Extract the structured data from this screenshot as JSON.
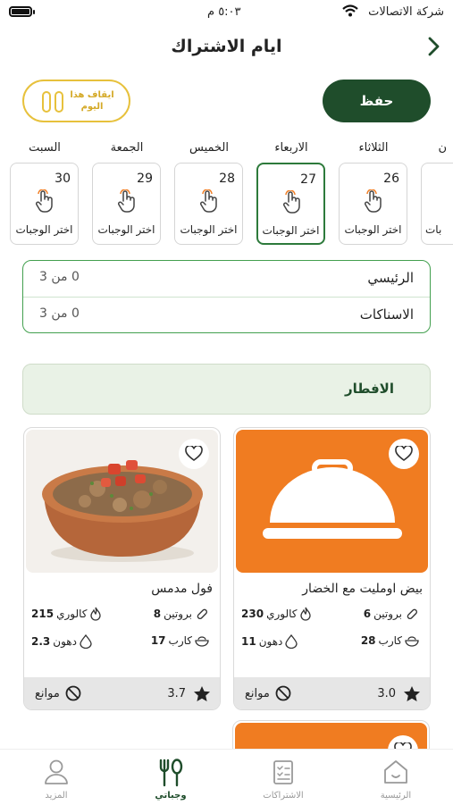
{
  "status_bar": {
    "carrier": "شركة الاتصالات",
    "time": "٥:٠٣ م"
  },
  "header": {
    "title": "ايام الاشتراك"
  },
  "actions": {
    "save": "حفظ",
    "pause": "ايقاف هذا اليوم"
  },
  "days": [
    {
      "name": "السبت",
      "number": "30",
      "action": "اختر الوجبات",
      "selected": false
    },
    {
      "name": "الجمعة",
      "number": "29",
      "action": "اختر الوجبات",
      "selected": false
    },
    {
      "name": "الخميس",
      "number": "28",
      "action": "اختر الوجبات",
      "selected": false
    },
    {
      "name": "الاربعاء",
      "number": "27",
      "action": "اختر الوجبات",
      "selected": true
    },
    {
      "name": "الثلاثاء",
      "number": "26",
      "action": "اختر الوجبات",
      "selected": false
    },
    {
      "name": "ن",
      "number": "",
      "action": "بات",
      "selected": false
    }
  ],
  "meal_counts": [
    {
      "label": "الرئيسي",
      "value": "0 من 3"
    },
    {
      "label": "الاسناكات",
      "value": "0 من 3"
    }
  ],
  "section": {
    "title": "الافطار"
  },
  "nutrient_labels": {
    "protein": "بروتين",
    "calories": "كالوري",
    "carbs": "كارب",
    "fats": "دهون"
  },
  "meals": [
    {
      "name": "بيض اومليت مع الخضار",
      "protein": "6",
      "calories": "230",
      "carbs": "28",
      "fats": "11",
      "rating": "3.0",
      "allergens": "موانع",
      "image": "placeholder-cloche",
      "image_bg": "#f07c21"
    },
    {
      "name": "فول مدمس",
      "protein": "8",
      "calories": "215",
      "carbs": "17",
      "fats": "2.3",
      "rating": "3.7",
      "allergens": "موانع",
      "image": "foul-bowl"
    }
  ],
  "tabs": [
    {
      "label": "الرئيسية",
      "icon": "home-icon",
      "active": false
    },
    {
      "label": "الاشتراكات",
      "icon": "subscriptions-icon",
      "active": false
    },
    {
      "label": "وجباتي",
      "icon": "utensils-icon",
      "active": true
    },
    {
      "label": "المزيد",
      "icon": "person-icon",
      "active": false
    }
  ],
  "colors": {
    "primary": "#1f4d2b",
    "accent_green": "#43a04f",
    "pause_yellow": "#e7c13c",
    "placeholder_orange": "#f07c21"
  }
}
